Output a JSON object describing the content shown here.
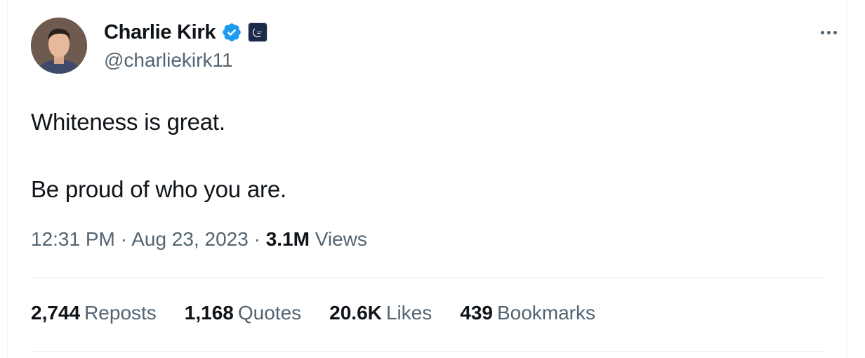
{
  "tweet": {
    "display_name": "Charlie Kirk",
    "handle": "@charliekirk11",
    "verified_icon": "verified-badge-icon",
    "affiliation_icon": "affiliate-org-logo",
    "paragraphs": [
      "Whiteness is great.",
      "Be proud of who you are."
    ],
    "time": "12:31 PM",
    "date": "Aug 23, 2023",
    "views_count": "3.1M",
    "views_label": "Views",
    "separator": "·"
  },
  "stats": {
    "reposts_count": "2,744",
    "reposts_label": "Reposts",
    "quotes_count": "1,168",
    "quotes_label": "Quotes",
    "likes_count": "20.6K",
    "likes_label": "Likes",
    "bookmarks_count": "439",
    "bookmarks_label": "Bookmarks"
  },
  "colors": {
    "text_primary": "#0f1419",
    "text_secondary": "#536471",
    "verified_blue": "#1d9bf0",
    "divider": "#eff3f4"
  }
}
